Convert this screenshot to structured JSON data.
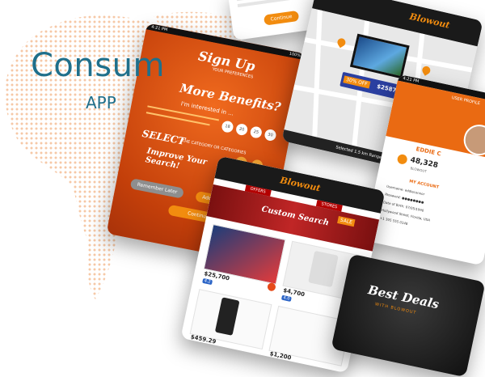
{
  "hero": {
    "title": "Consum",
    "subtitle": "APP"
  },
  "signup": {
    "status_time": "4:21 PM",
    "status_batt": "100%",
    "title": "Sign Up",
    "subtitle": "YOUR PREFERENCES",
    "more_benefits": "More Benefits?",
    "interested": "I'm interested in ...",
    "select": "SELECT",
    "select_sub": "THE CATEGORY OR CATEGORIES",
    "improve": "Improve Your Search!",
    "btn_remember": "Remember Later",
    "btn_add": "Add Categories",
    "btn_continue": "Continue",
    "radio_a": "18",
    "radio_b": "20",
    "radio_c": "25",
    "radio_d": "30"
  },
  "topcard": {
    "btn": "Continue"
  },
  "map": {
    "logo": "Blowout",
    "price_bar": "30% OFF",
    "price_val": "$2587",
    "footer": "Selected 1.5 km  Range 10 km"
  },
  "profile": {
    "status_time": "4:21 PM",
    "header": "USER PROFILE",
    "name": "EDDIE C",
    "points": "48,328",
    "points_label": "BLOWOUT",
    "my_account": "MY ACCOUNT",
    "row1": "Username: eddieconnor",
    "row2": "Password: ●●●●●●●●",
    "row3": "Date of Birth: 07/05/1990",
    "row4": "Hollywood Street, Florida, USA",
    "row5": "+1 305 555 0148"
  },
  "deals": {
    "logo": "Blowout",
    "tab1": "OFFERS",
    "tab2": "STORES",
    "banner": "Custom Search",
    "sale": "SALE",
    "items": [
      {
        "price": "$25,700",
        "rating": "4.2"
      },
      {
        "price": "$4,700",
        "rating": "4.0"
      },
      {
        "price": "$459.29",
        "rating": "4.5"
      },
      {
        "price": "$1,200",
        "rating": "4.1"
      }
    ]
  },
  "bestdeals": {
    "line1": "Best Deals",
    "line2": "WITH BLOWOUT"
  }
}
